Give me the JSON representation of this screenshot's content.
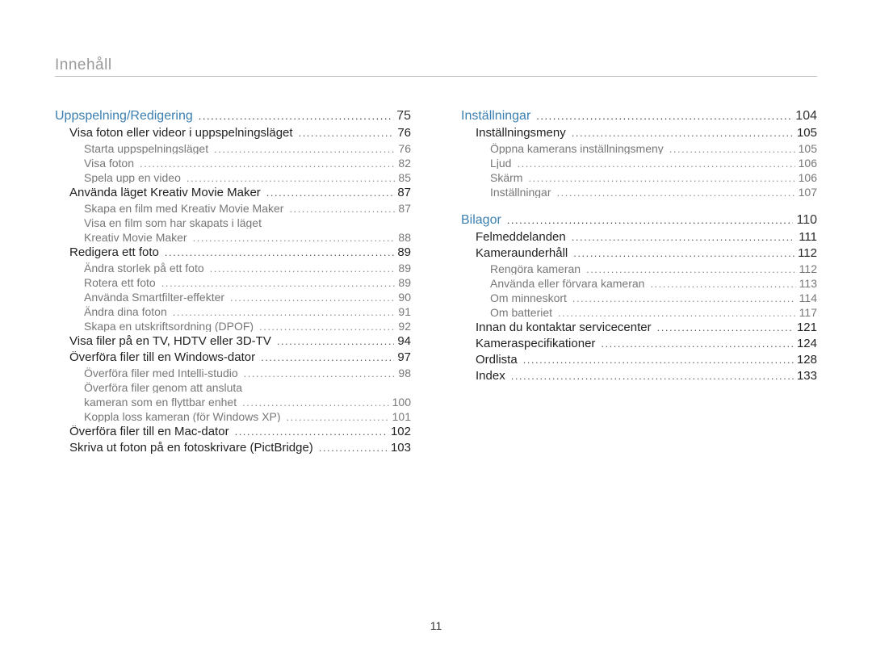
{
  "title": "Innehåll",
  "pageNumber": "11",
  "left": [
    {
      "label": "Uppspelning/Redigering",
      "page": "75",
      "level": 1
    },
    {
      "label": "Visa foton eller videor i uppspelningsläget",
      "page": "76",
      "level": 2
    },
    {
      "label": "Starta uppspelningsläget",
      "page": "76",
      "level": 3
    },
    {
      "label": "Visa foton",
      "page": "82",
      "level": 3
    },
    {
      "label": "Spela upp en video",
      "page": "85",
      "level": 3
    },
    {
      "label": "Använda läget Kreativ Movie Maker",
      "page": "87",
      "level": 2
    },
    {
      "label": "Skapa en film med Kreativ Movie Maker",
      "page": "87",
      "level": 3
    },
    {
      "label": "Visa en film som har skapats i läget",
      "page": "",
      "level": 3,
      "nopage": true
    },
    {
      "label": "Kreativ Movie Maker",
      "page": "88",
      "level": 3
    },
    {
      "label": "Redigera ett foto",
      "page": "89",
      "level": 2
    },
    {
      "label": "Ändra storlek på ett foto",
      "page": "89",
      "level": 3
    },
    {
      "label": "Rotera ett foto",
      "page": "89",
      "level": 3
    },
    {
      "label": "Använda Smartfilter-effekter",
      "page": "90",
      "level": 3
    },
    {
      "label": "Ändra dina foton",
      "page": "91",
      "level": 3
    },
    {
      "label": "Skapa en utskriftsordning (DPOF)",
      "page": "92",
      "level": 3
    },
    {
      "label": "Visa filer på en TV, HDTV eller 3D-TV",
      "page": "94",
      "level": 2
    },
    {
      "label": "Överföra filer till en Windows-dator",
      "page": "97",
      "level": 2
    },
    {
      "label": "Överföra filer med Intelli-studio",
      "page": "98",
      "level": 3
    },
    {
      "label": "Överföra filer genom att ansluta",
      "page": "",
      "level": 3,
      "nopage": true
    },
    {
      "label": "kameran som en flyttbar enhet",
      "page": "100",
      "level": 3
    },
    {
      "label": "Koppla loss kameran (för Windows XP)",
      "page": "101",
      "level": 3
    },
    {
      "label": "Överföra filer till en Mac-dator",
      "page": "102",
      "level": 2
    },
    {
      "label": "Skriva ut foton på en fotoskrivare (PictBridge)",
      "page": "103",
      "level": 2
    }
  ],
  "right": [
    {
      "label": "Inställningar",
      "page": "104",
      "level": 1
    },
    {
      "label": "Inställningsmeny",
      "page": "105",
      "level": 2
    },
    {
      "label": "Öppna kamerans inställningsmeny",
      "page": "105",
      "level": 3
    },
    {
      "label": "Ljud",
      "page": "106",
      "level": 3
    },
    {
      "label": "Skärm",
      "page": "106",
      "level": 3
    },
    {
      "label": "Inställningar",
      "page": "107",
      "level": 3
    },
    {
      "label": "Bilagor",
      "page": "110",
      "level": 1,
      "gap": true
    },
    {
      "label": "Felmeddelanden",
      "page": "111",
      "level": 2
    },
    {
      "label": "Kameraunderhåll",
      "page": "112",
      "level": 2
    },
    {
      "label": "Rengöra kameran",
      "page": "112",
      "level": 3
    },
    {
      "label": "Använda eller förvara kameran",
      "page": "113",
      "level": 3
    },
    {
      "label": "Om minneskort",
      "page": "114",
      "level": 3
    },
    {
      "label": "Om batteriet",
      "page": "117",
      "level": 3
    },
    {
      "label": "Innan du kontaktar servicecenter",
      "page": "121",
      "level": 2
    },
    {
      "label": "Kameraspecifikationer",
      "page": "124",
      "level": 2
    },
    {
      "label": "Ordlista",
      "page": "128",
      "level": 2
    },
    {
      "label": "Index",
      "page": "133",
      "level": 2
    }
  ]
}
